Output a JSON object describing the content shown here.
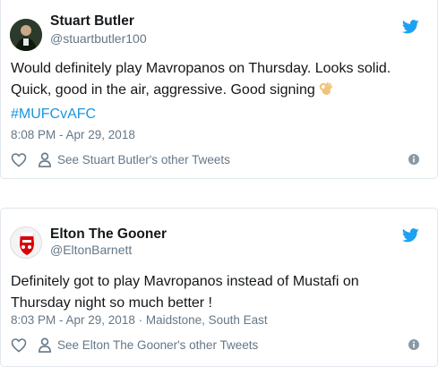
{
  "tweets": [
    {
      "name": "Stuart Butler",
      "handle": "@stuartbutler100",
      "text_line1": "Would definitely play Mavropanos on Thursday. Looks solid.",
      "text_line2": "Quick, good in the air, aggressive. Good signing",
      "emoji": "ok-hand",
      "hashtag": "#MUFCvAFC",
      "meta": "8:08 PM - Apr 29, 2018",
      "other_tweets": "See Stuart Butler's other Tweets"
    },
    {
      "name": "Elton The Gooner",
      "handle": "@EltonBarnett",
      "text_line1": "Definitely got to play Mavropanos instead of Mustafi on",
      "text_line2": "Thursday night so much better !",
      "meta": "8:03 PM - Apr 29, 2018 · Maidstone, South East",
      "other_tweets": "See Elton The Gooner's other Tweets"
    }
  ],
  "colors": {
    "twitter_blue": "#1da1f2",
    "hashtag": "#1b95e0",
    "secondary_text": "#657786",
    "border": "#e1e8ed"
  }
}
